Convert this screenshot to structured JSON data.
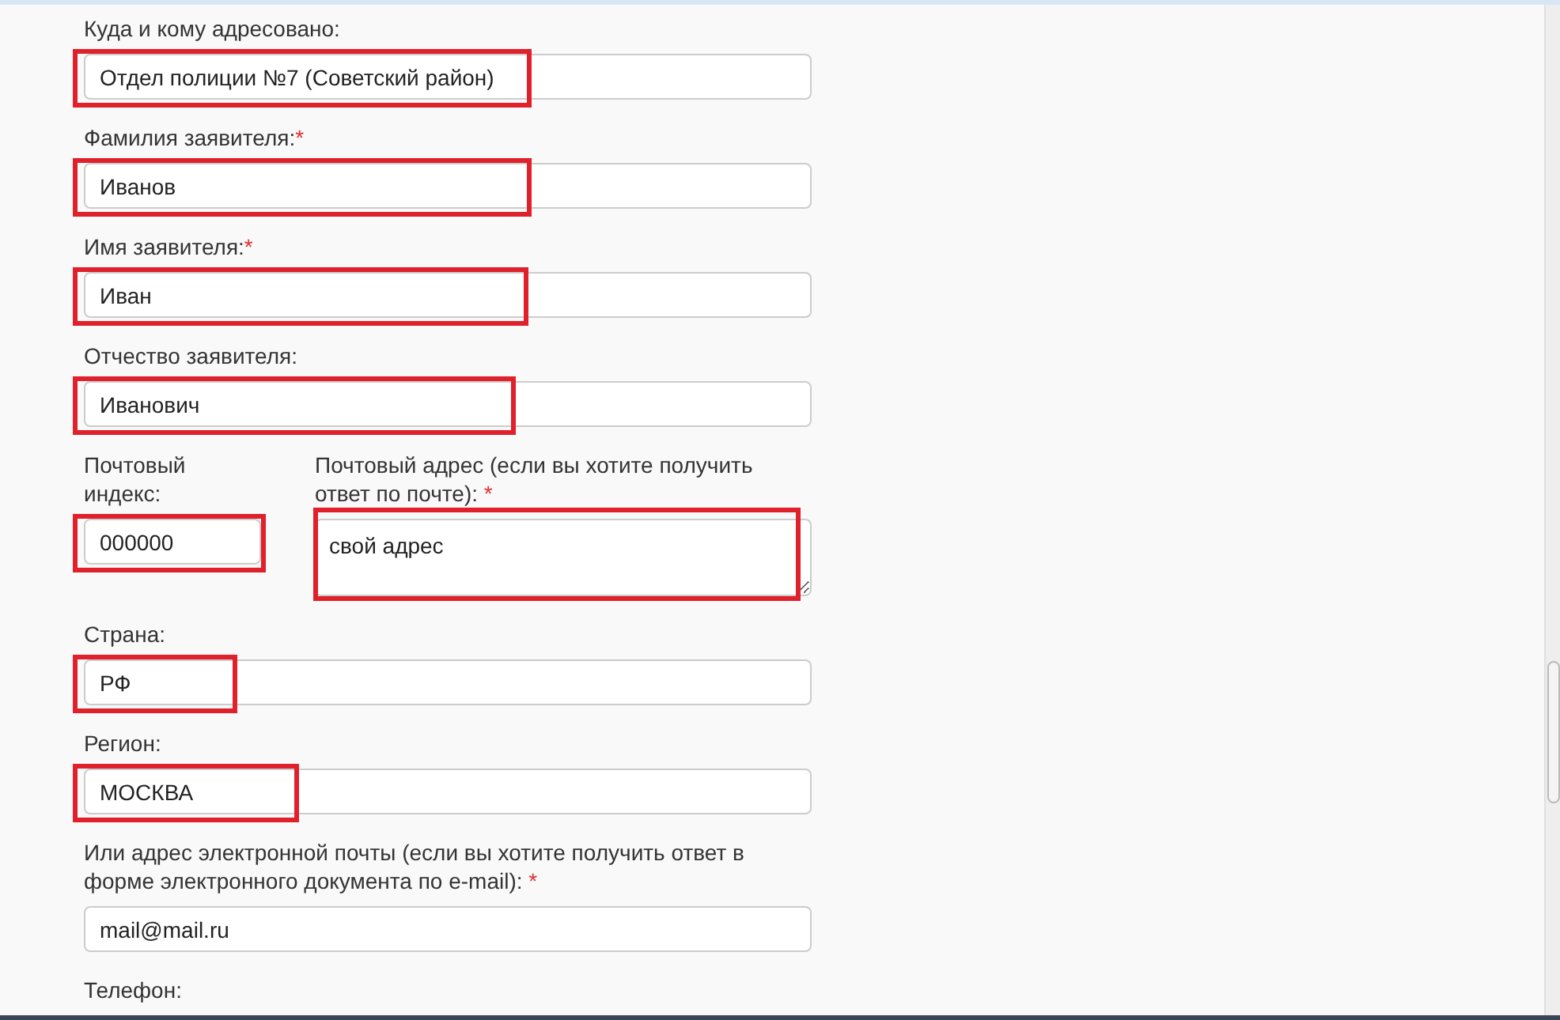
{
  "fields": [
    {
      "kind": "input",
      "label": "Куда и кому адресовано:",
      "value": "Отдел полиции №7 (Советский район)",
      "highlighted": true
    },
    {
      "kind": "input",
      "label": "Фамилия заявителя:",
      "required_mark": "*",
      "value": "Иванов",
      "highlighted": true
    },
    {
      "kind": "input",
      "label": "Имя заявителя:",
      "required_mark": "*",
      "value": "Иван",
      "highlighted": true
    },
    {
      "kind": "input",
      "label": "Отчество заявителя:",
      "value": "Иванович",
      "highlighted": true
    },
    {
      "kind": "pair",
      "items": [
        {
          "kind": "input",
          "label": "Почтовый индекс:",
          "value": "000000",
          "highlighted": true
        },
        {
          "kind": "textarea",
          "label": "Почтовый адрес (если вы хотите получить ответ по почте): ",
          "required_mark": "*",
          "value": "свой адрес",
          "highlighted": true
        }
      ]
    },
    {
      "kind": "input",
      "label": "Страна:",
      "value": "РФ",
      "highlighted": true
    },
    {
      "kind": "input",
      "label": "Регион:",
      "value": "МОСКВА",
      "highlighted": true
    },
    {
      "kind": "input",
      "label": "Или адрес электронной почты (если вы хотите получить ответ в форме электронного документа по e-mail): ",
      "required_mark": "*",
      "value": "mail@mail.ru",
      "highlighted": false
    },
    {
      "kind": "label",
      "label": "Телефон:"
    }
  ]
}
